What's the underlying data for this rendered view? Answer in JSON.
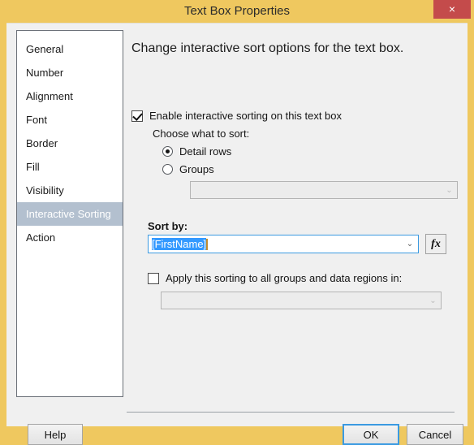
{
  "window": {
    "title": "Text Box Properties",
    "close_icon": "close-icon",
    "close_glyph": "×",
    "titlebar_color": "#efc85f",
    "close_color": "#c44b4b"
  },
  "sidebar": {
    "items": [
      {
        "label": "General",
        "selected": false
      },
      {
        "label": "Number",
        "selected": false
      },
      {
        "label": "Alignment",
        "selected": false
      },
      {
        "label": "Font",
        "selected": false
      },
      {
        "label": "Border",
        "selected": false
      },
      {
        "label": "Fill",
        "selected": false
      },
      {
        "label": "Visibility",
        "selected": false
      },
      {
        "label": "Interactive Sorting",
        "selected": true
      },
      {
        "label": "Action",
        "selected": false
      }
    ],
    "selected_color": "#b3c0cf"
  },
  "main": {
    "heading": "Change interactive sort options for the text box.",
    "enable_sorting": {
      "label": "Enable interactive sorting on this text box",
      "checked": true
    },
    "choose_label": "Choose what to sort:",
    "radios": [
      {
        "label": "Detail rows",
        "selected": true
      },
      {
        "label": "Groups",
        "selected": false
      }
    ],
    "groups_combo": {
      "value": "",
      "disabled": true,
      "arrow_icon": "chevron-down-icon",
      "arrow_glyph": "⌄"
    },
    "sort_by": {
      "label": "Sort by:",
      "value": "[FirstName]",
      "selected_text": true,
      "selection_color": "#3399ff",
      "arrow_icon": "chevron-down-icon",
      "arrow_glyph": "⌄",
      "focus_border_color": "#3b9ae1"
    },
    "expression_button": {
      "label": "fx",
      "icon": "function-icon"
    },
    "apply_all": {
      "label": "Apply this sorting to all groups and data regions in:",
      "checked": false
    },
    "apply_combo": {
      "value": "",
      "disabled": true,
      "arrow_icon": "chevron-down-icon",
      "arrow_glyph": "⌄"
    }
  },
  "footer": {
    "help_label": "Help",
    "ok_label": "OK",
    "cancel_label": "Cancel",
    "default_button_color": "#3b9ae1"
  }
}
